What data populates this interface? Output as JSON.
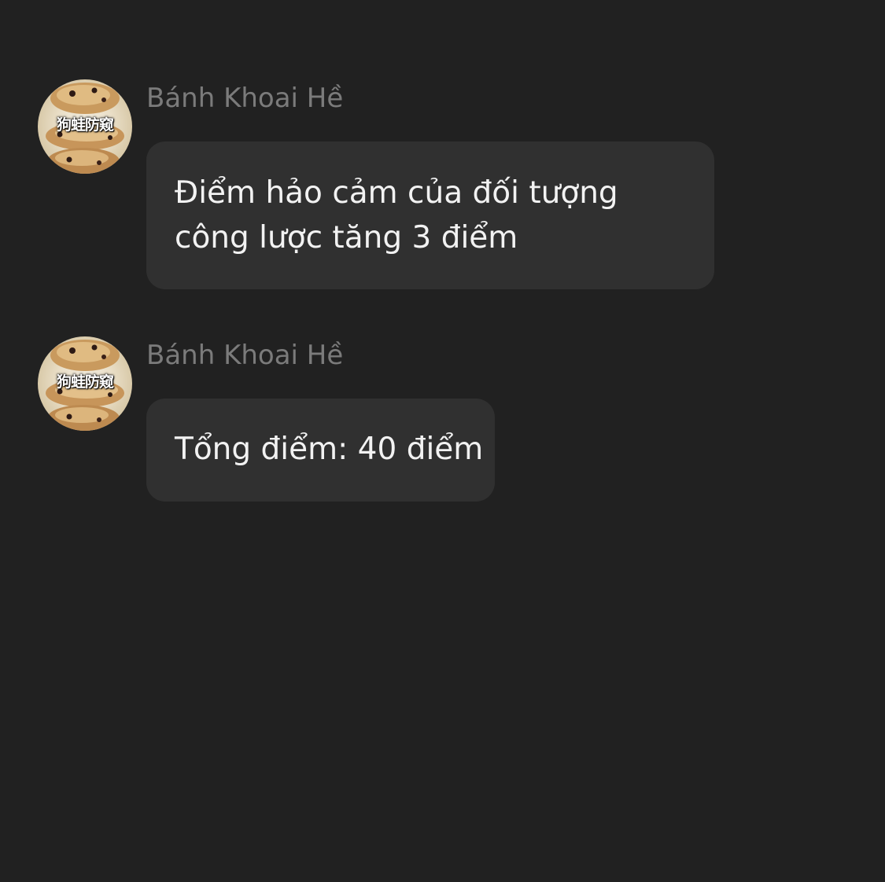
{
  "messages": [
    {
      "sender": "Bánh Khoai Hề",
      "avatar_caption": "狗蛙防窥",
      "text": "Điểm hảo cảm của đối tượng công lược tăng 3 điểm"
    },
    {
      "sender": "Bánh Khoai Hề",
      "avatar_caption": "狗蛙防窥",
      "text": "Tổng điểm: 40 điểm"
    }
  ],
  "colors": {
    "background": "#212121",
    "bubble": "#303030",
    "sender_text": "#7b7b7b",
    "message_text": "#f2f2f2"
  }
}
